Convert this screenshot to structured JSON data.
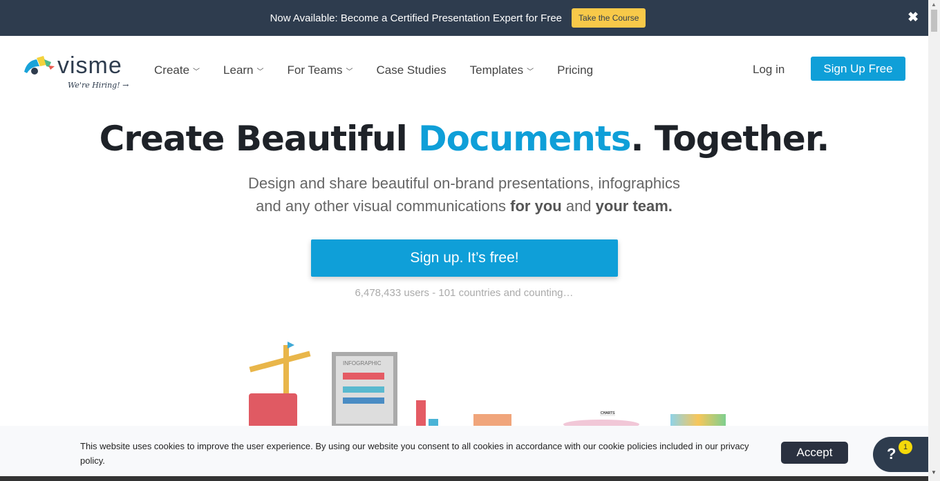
{
  "banner": {
    "text": "Now Available: Become a Certified Presentation Expert for Free",
    "button": "Take the Course",
    "close_icon": "close-icon"
  },
  "logo": {
    "word": "visme",
    "hiring": "We're Hiring! →"
  },
  "nav": {
    "items": [
      {
        "label": "Create",
        "dropdown": true
      },
      {
        "label": "Learn",
        "dropdown": true
      },
      {
        "label": "For Teams",
        "dropdown": true
      },
      {
        "label": "Case Studies",
        "dropdown": false
      },
      {
        "label": "Templates",
        "dropdown": true
      },
      {
        "label": "Pricing",
        "dropdown": false
      }
    ],
    "login": "Log in",
    "signup": "Sign Up Free"
  },
  "hero": {
    "title_a": "Create Beautiful ",
    "title_highlight": "Documents",
    "title_b": ". Together.",
    "sub_line1": "Design and share beautiful on-brand presentations, infographics",
    "sub_line2_a": "and any other visual communications ",
    "sub_bold1": "for you",
    "sub_line2_b": " and ",
    "sub_bold2": "your team.",
    "cta": "Sign up. It’s free!",
    "stats": "6,478,433 users - 101 countries and counting…"
  },
  "illustration": {
    "infographic_label": "INFOGRAPHIC",
    "charts_label": "CHARTS"
  },
  "cookie": {
    "message": "This website uses cookies to improve the user experience. By using our website you consent to all cookies in accordance with our cookie policies included in our privacy policy.",
    "accept": "Accept"
  },
  "help": {
    "label": "?",
    "badge": "1"
  },
  "colors": {
    "accent": "#0f9fd8",
    "banner": "#2e3c4e",
    "course_button": "#f8c949"
  }
}
